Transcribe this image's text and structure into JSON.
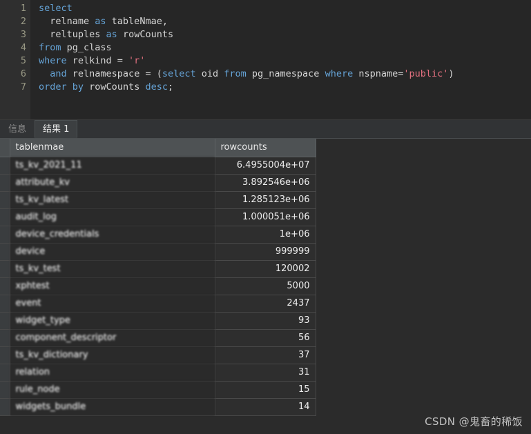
{
  "editor": {
    "line_numbers": [
      "1",
      "2",
      "3",
      "4",
      "5",
      "6",
      "7"
    ],
    "lines": [
      {
        "n": "1",
        "tokens": [
          {
            "t": "select",
            "c": "kw"
          }
        ]
      },
      {
        "n": "2",
        "tokens": [
          {
            "t": "  relname ",
            "c": "id"
          },
          {
            "t": "as",
            "c": "kw"
          },
          {
            "t": " tableNmae,",
            "c": "id"
          }
        ]
      },
      {
        "n": "3",
        "tokens": [
          {
            "t": "  reltuples ",
            "c": "id"
          },
          {
            "t": "as",
            "c": "kw"
          },
          {
            "t": " rowCounts",
            "c": "id"
          }
        ]
      },
      {
        "n": "4",
        "tokens": [
          {
            "t": "from",
            "c": "kw"
          },
          {
            "t": " pg_class",
            "c": "id"
          }
        ]
      },
      {
        "n": "5",
        "tokens": [
          {
            "t": "where",
            "c": "kw"
          },
          {
            "t": " relkind = ",
            "c": "id"
          },
          {
            "t": "'r'",
            "c": "str"
          }
        ]
      },
      {
        "n": "6",
        "tokens": [
          {
            "t": "  ",
            "c": "id"
          },
          {
            "t": "and",
            "c": "kw"
          },
          {
            "t": " relnamespace = (",
            "c": "id"
          },
          {
            "t": "select",
            "c": "kw"
          },
          {
            "t": " oid ",
            "c": "id"
          },
          {
            "t": "from",
            "c": "kw"
          },
          {
            "t": " pg_namespace ",
            "c": "id"
          },
          {
            "t": "where",
            "c": "kw"
          },
          {
            "t": " nspname=",
            "c": "id"
          },
          {
            "t": "'public'",
            "c": "str"
          },
          {
            "t": ")",
            "c": "id"
          }
        ]
      },
      {
        "n": "7",
        "tokens": [
          {
            "t": "order",
            "c": "kw"
          },
          {
            "t": " ",
            "c": "id"
          },
          {
            "t": "by",
            "c": "kw"
          },
          {
            "t": " rowCounts ",
            "c": "id"
          },
          {
            "t": "desc",
            "c": "kw"
          },
          {
            "t": ";",
            "c": "id"
          }
        ]
      }
    ],
    "full_text": "select\n  relname as tableNmae,\n  reltuples as rowCounts\nfrom pg_class\nwhere relkind = 'r'\n  and relnamespace = (select oid from pg_namespace where nspname='public')\norder by rowCounts desc;"
  },
  "tabs": [
    {
      "label": "信息",
      "active": false
    },
    {
      "label": "结果 1",
      "active": true
    }
  ],
  "result_grid": {
    "columns": [
      "tablenmae",
      "rowcounts"
    ],
    "rows": [
      {
        "tablenmae": "ts_kv_2021_11",
        "rowcounts": "6.4955004e+07"
      },
      {
        "tablenmae": "attribute_kv",
        "rowcounts": "3.892546e+06"
      },
      {
        "tablenmae": "ts_kv_latest",
        "rowcounts": "1.285123e+06"
      },
      {
        "tablenmae": "audit_log",
        "rowcounts": "1.000051e+06"
      },
      {
        "tablenmae": "device_credentials",
        "rowcounts": "1e+06"
      },
      {
        "tablenmae": "device",
        "rowcounts": "999999"
      },
      {
        "tablenmae": "ts_kv_test",
        "rowcounts": "120002"
      },
      {
        "tablenmae": "xphtest",
        "rowcounts": "5000"
      },
      {
        "tablenmae": "event",
        "rowcounts": "2437"
      },
      {
        "tablenmae": "widget_type",
        "rowcounts": "93"
      },
      {
        "tablenmae": "component_descriptor",
        "rowcounts": "56"
      },
      {
        "tablenmae": "ts_kv_dictionary",
        "rowcounts": "37"
      },
      {
        "tablenmae": "relation",
        "rowcounts": "31"
      },
      {
        "tablenmae": "rule_node",
        "rowcounts": "15"
      },
      {
        "tablenmae": "widgets_bundle",
        "rowcounts": "14"
      }
    ]
  },
  "watermark": {
    "text": "CSDN @鬼畜的稀饭"
  },
  "colors": {
    "editor_bg": "#262626",
    "gutter_bg": "#2f2f2f",
    "panel_bg": "#2b2b2b",
    "tab_active_bg": "#3c3f41",
    "tabbar_bg": "#313335",
    "grid_header_bg": "#4e5254",
    "grid_cell_bg": "#2e2e2e",
    "keyword": "#65a3d6",
    "string": "#e2707f",
    "identifier": "#d6d6d6",
    "lineno": "#9a9a86"
  }
}
